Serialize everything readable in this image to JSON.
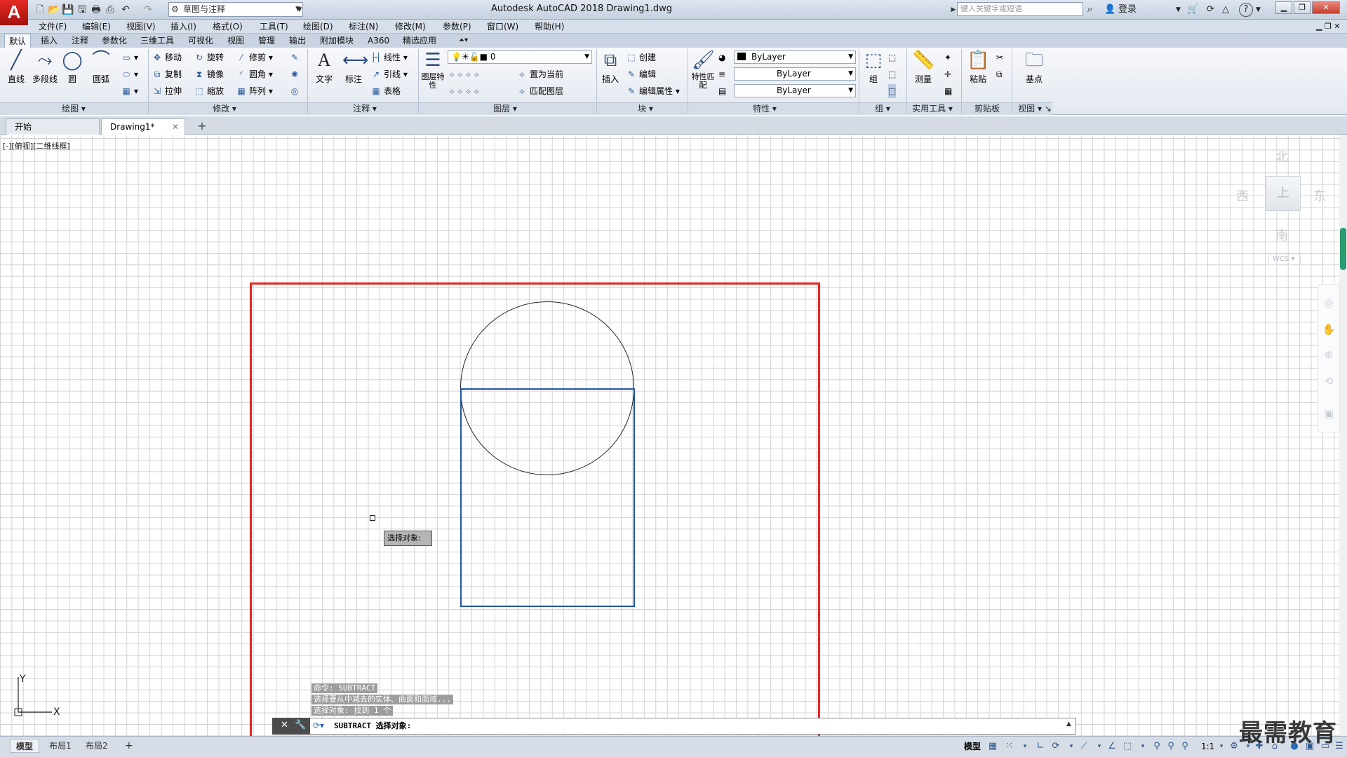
{
  "app": {
    "logo": "A",
    "title": "Autodesk AutoCAD 2018    Drawing1.dwg",
    "workspace": "草图与注释",
    "search_placeholder": "键入关键字或短语",
    "login": "登录",
    "help": "?"
  },
  "menu": [
    "文件(F)",
    "编辑(E)",
    "视图(V)",
    "插入(I)",
    "格式(O)",
    "工具(T)",
    "绘图(D)",
    "标注(N)",
    "修改(M)",
    "参数(P)",
    "窗口(W)",
    "帮助(H)"
  ],
  "ribbon_tabs": [
    "默认",
    "插入",
    "注释",
    "参数化",
    "三维工具",
    "可视化",
    "视图",
    "管理",
    "输出",
    "附加模块",
    "A360",
    "精选应用"
  ],
  "ribbon": {
    "draw": {
      "title": "绘图",
      "line": "直线",
      "pline": "多段线",
      "circle": "圆",
      "arc": "圆弧"
    },
    "modify": {
      "title": "修改",
      "move": "移动",
      "rotate": "旋转",
      "trim": "修剪",
      "copy": "复制",
      "mirror": "镜像",
      "fillet": "圆角",
      "stretch": "拉伸",
      "scale": "缩放",
      "array": "阵列"
    },
    "annotation": {
      "title": "注释",
      "text": "文字",
      "dimension": "标注",
      "linear": "线性",
      "leader": "引线",
      "table": "表格"
    },
    "layers": {
      "title": "图层",
      "props": "图层特性",
      "current_layer": "0",
      "make_current": "置为当前",
      "match": "匹配图层"
    },
    "block": {
      "title": "块",
      "insert": "插入",
      "create": "创建",
      "edit": "编辑",
      "edit_attr": "编辑属性"
    },
    "properties": {
      "title": "特性",
      "match": "特性匹配",
      "color": "ByLayer",
      "linetype": "ByLayer",
      "lineweight": "ByLayer"
    },
    "groups": {
      "title": "组",
      "group": "组"
    },
    "utilities": {
      "title": "实用工具",
      "measure": "测量"
    },
    "clipboard": {
      "title": "剪贴板",
      "paste": "粘贴"
    },
    "view": {
      "title": "视图",
      "base": "基点"
    }
  },
  "doc_tabs": {
    "start": "开始",
    "drawing": "Drawing1*",
    "close": "✕",
    "add": "+"
  },
  "viewport_label": "[-][俯视][二维线框]",
  "viewcube": {
    "n": "北",
    "s": "南",
    "e": "东",
    "w": "西",
    "top": "上",
    "wcs": "WCS"
  },
  "tooltip": "选择对象:",
  "ucs": {
    "x": "X",
    "y": "Y"
  },
  "command_history": [
    "命令: SUBTRACT",
    "选择要从中减去的实体、曲面和面域...",
    "选择对象: 找到 1 个"
  ],
  "command_line": "SUBTRACT 选择对象:",
  "layout_tabs": [
    "模型",
    "布局1",
    "布局2",
    "+"
  ],
  "status": {
    "model": "模型",
    "scale": "1:1"
  },
  "watermark": "最需教育"
}
